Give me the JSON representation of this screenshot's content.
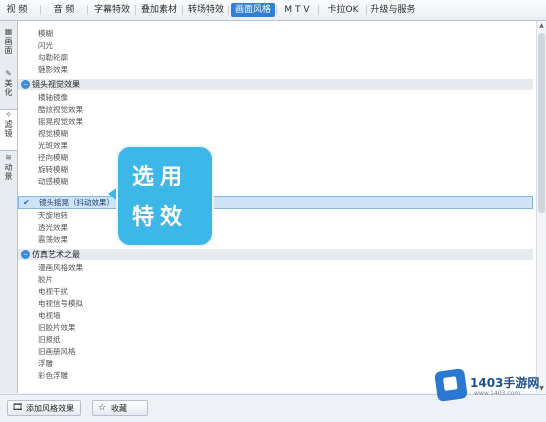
{
  "top_tabs": [
    "视 频",
    "音 频",
    "字幕特效",
    "叠加素材",
    "转场特效",
    "画面风格",
    "M T V",
    "卡拉OK",
    "升级与服务"
  ],
  "active_tab": "画面风格",
  "side_tabs": [
    {
      "icon": "image-icon",
      "label": "画面"
    },
    {
      "icon": "wand-icon",
      "label": "美化"
    },
    {
      "icon": "filter-icon",
      "label": "滤镜"
    },
    {
      "icon": "wave-icon",
      "label": "动景"
    }
  ],
  "effects": {
    "items_top": [
      "模糊",
      "闪光",
      "勾勒轮廓",
      "魅影效果"
    ],
    "group1": "镜头视觉效果",
    "group1_items": [
      "横轴镜像",
      "酷炫视觉效果",
      "摇晃视觉效果",
      "视觉模糊",
      "光斑效果",
      "径向模糊",
      "旋转模糊",
      "动感模糊",
      "镜头摇晃（抖动效果）",
      "天旋地转",
      "透光效果",
      "震荡效果"
    ],
    "selected_item": "镜头摇晃（抖动效果）",
    "group2": "仿真艺术之最",
    "group2_items": [
      "漫画风格效果",
      "胶片",
      "电视干扰",
      "电视信号模拟",
      "电视墙",
      "旧胶片效果",
      "旧报纸",
      "旧画册风格",
      "浮雕",
      "彩色浮雕"
    ]
  },
  "callout": {
    "line1": "选用",
    "line2": "特效"
  },
  "buttons": {
    "add": "添加风格效果",
    "collect": "收藏"
  },
  "watermark": {
    "brand": "1403手游网",
    "url": "www.1403.com"
  },
  "colors": {
    "accent": "#2f7fd6",
    "callout": "#3db6e8",
    "selected": "#cfe3f7"
  }
}
